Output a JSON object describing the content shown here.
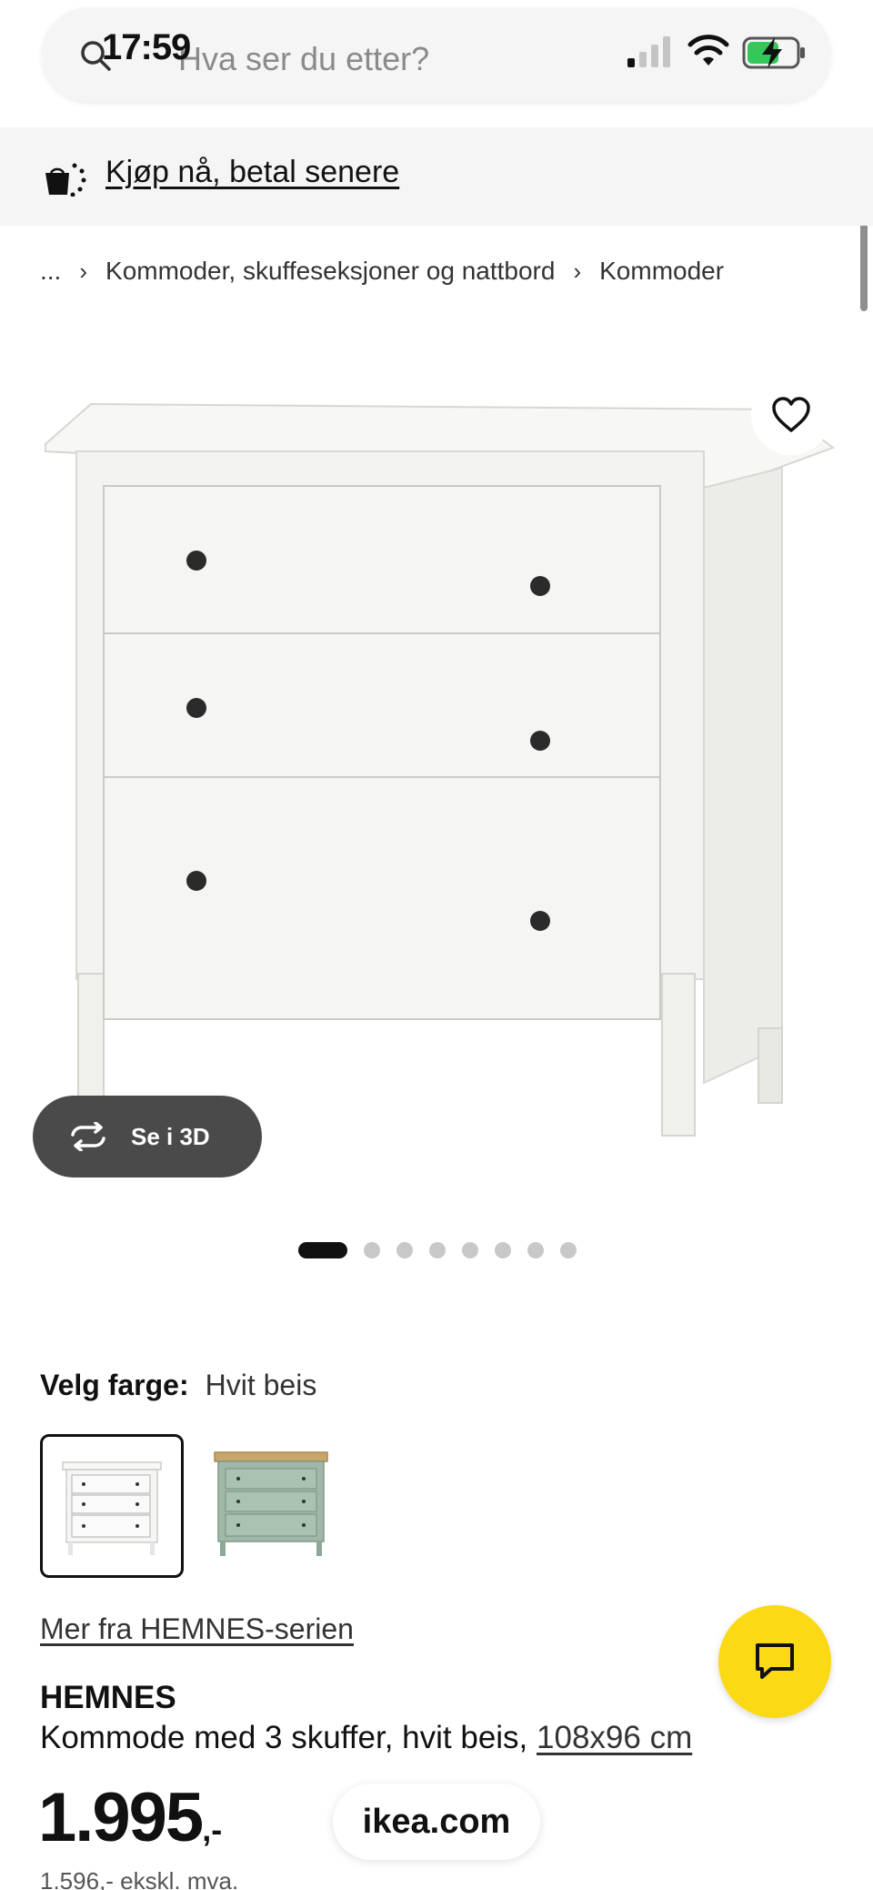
{
  "status_bar": {
    "time": "17:59"
  },
  "search": {
    "placeholder": "Hva ser du etter?"
  },
  "promo": {
    "link_text": "Kjøp nå, betal senere"
  },
  "breadcrumb": {
    "items": [
      "...",
      "Kommoder, skuffeseksjoner og nattbord",
      "Kommoder"
    ]
  },
  "gallery": {
    "view_3d_label": "Se i 3D",
    "dot_count": 8,
    "active_dot": 1
  },
  "color_picker": {
    "label": "Velg farge:",
    "selected_value": "Hvit beis",
    "swatches": [
      {
        "color_name": "white",
        "color": "#f4f4f2"
      },
      {
        "color_name": "green",
        "color": "#9fb8a8"
      }
    ]
  },
  "series_link": "Mer fra HEMNES-serien",
  "product": {
    "name": "HEMNES",
    "description": "Kommode med 3 skuffer, hvit beis,",
    "size": "108x96 cm"
  },
  "price": {
    "amount": "1.995",
    "suffix": ",-",
    "ex_vat": "1.596,- ekskl. mva."
  },
  "browser": {
    "url": "ikea.com"
  },
  "colors": {
    "brand_yellow": "#fbd914",
    "dark_button": "#4a4a4a",
    "text": "#111111"
  }
}
